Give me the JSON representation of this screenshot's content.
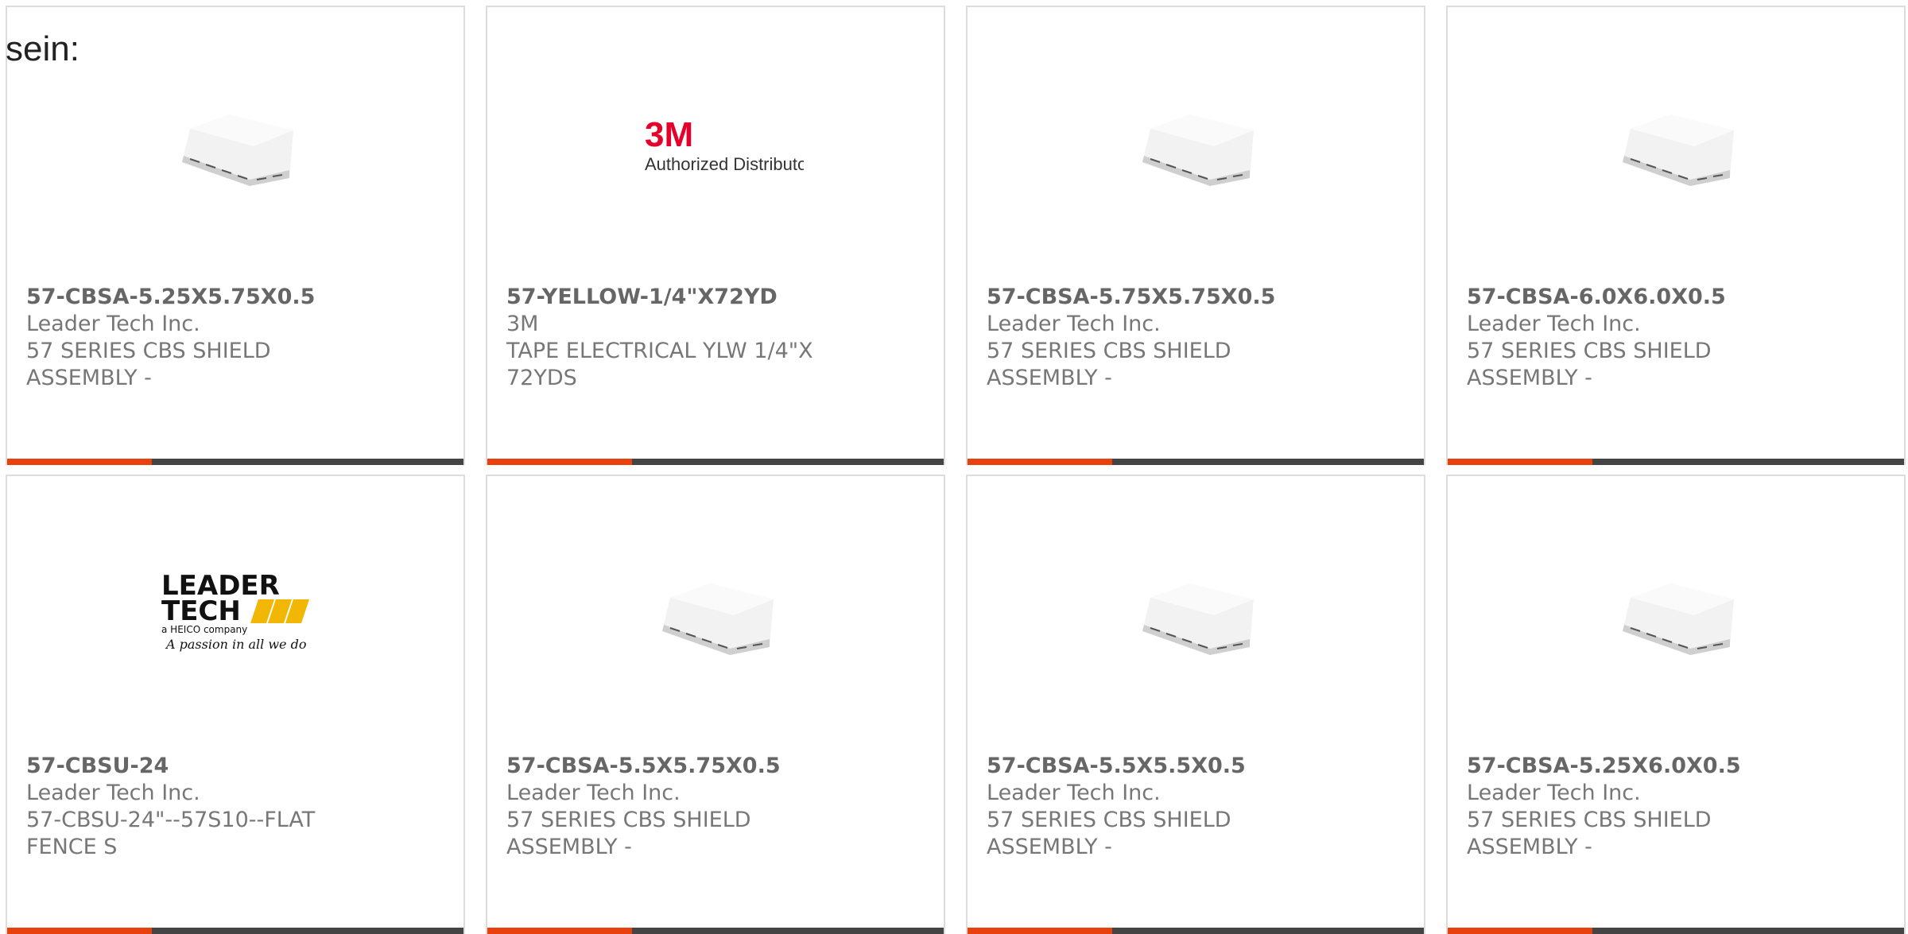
{
  "page": {
    "heading": "sein:"
  },
  "colors": {
    "accent": "#e8410e",
    "bar": "#444444",
    "border": "#dcdcdc",
    "text": "#777777"
  },
  "products": [
    {
      "part_number": "57-CBSA-5.25X5.75X0.5",
      "manufacturer": "Leader Tech Inc.",
      "description": "57 SERIES CBS SHIELD ASSEMBLY -",
      "image": "shield-assembly-image"
    },
    {
      "part_number": "57-YELLOW-1/4\"X72YD",
      "manufacturer": "3M",
      "description": "TAPE ELECTRICAL YLW 1/4\"X 72YDS",
      "image": "3m-authorized-distributor-logo",
      "logo_text": [
        "3M",
        "Authorized Distributor"
      ]
    },
    {
      "part_number": "57-CBSA-5.75X5.75X0.5",
      "manufacturer": "Leader Tech Inc.",
      "description": "57 SERIES CBS SHIELD ASSEMBLY -",
      "image": "shield-assembly-image"
    },
    {
      "part_number": "57-CBSA-6.0X6.0X0.5",
      "manufacturer": "Leader Tech Inc.",
      "description": "57 SERIES CBS SHIELD ASSEMBLY -",
      "image": "shield-assembly-image"
    },
    {
      "part_number": "57-CBSU-24",
      "manufacturer": "Leader Tech Inc.",
      "description": "57-CBSU-24\"--57S10--FLAT FENCE S",
      "image": "leader-tech-logo",
      "logo_text": [
        "LEADER",
        "TECH",
        "a HEICO company",
        "A passion in all we do"
      ]
    },
    {
      "part_number": "57-CBSA-5.5X5.75X0.5",
      "manufacturer": "Leader Tech Inc.",
      "description": "57 SERIES CBS SHIELD ASSEMBLY -",
      "image": "shield-assembly-image"
    },
    {
      "part_number": "57-CBSA-5.5X5.5X0.5",
      "manufacturer": "Leader Tech Inc.",
      "description": "57 SERIES CBS SHIELD ASSEMBLY -",
      "image": "shield-assembly-image"
    },
    {
      "part_number": "57-CBSA-5.25X6.0X0.5",
      "manufacturer": "Leader Tech Inc.",
      "description": "57 SERIES CBS SHIELD ASSEMBLY -",
      "image": "shield-assembly-image"
    }
  ]
}
